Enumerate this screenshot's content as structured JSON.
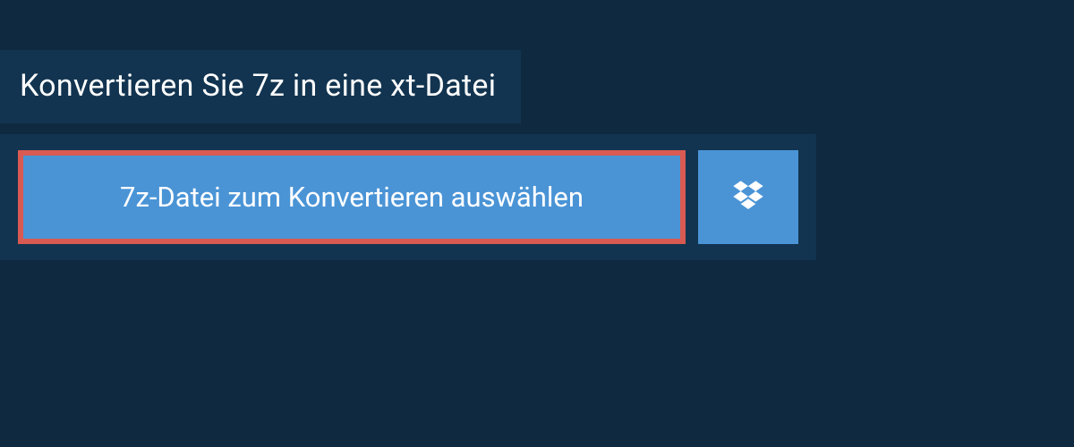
{
  "header": {
    "title": "Konvertieren Sie 7z in eine xt-Datei"
  },
  "upload": {
    "select_button_label": "7z-Datei zum Konvertieren auswählen",
    "dropbox_icon": "dropbox-icon"
  },
  "colors": {
    "page_bg": "#0f2a40",
    "panel_bg": "#123450",
    "button_bg": "#4a94d6",
    "highlight_border": "#d85a52",
    "text": "#ffffff"
  }
}
